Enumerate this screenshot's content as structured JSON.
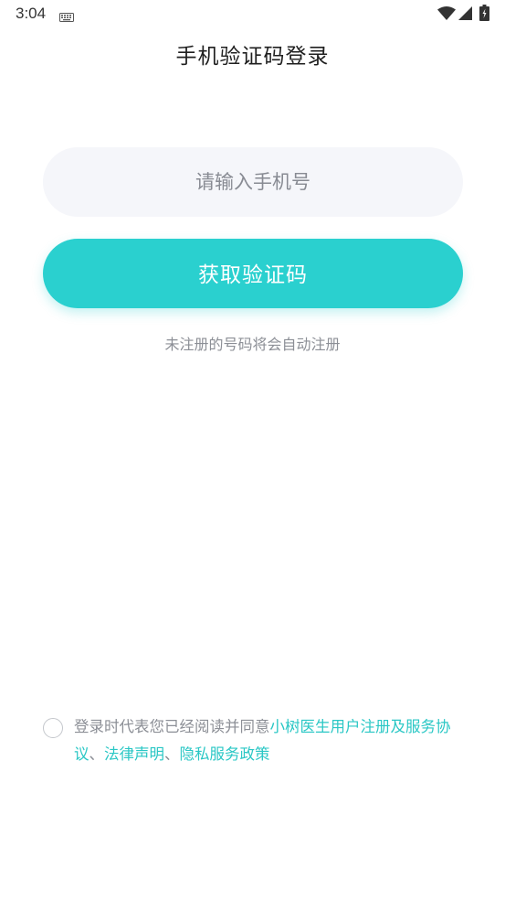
{
  "status_bar": {
    "time": "3:04"
  },
  "header": {
    "title": "手机验证码登录"
  },
  "form": {
    "phone_placeholder": "请输入手机号",
    "phone_value": "",
    "get_code_label": "获取验证码",
    "register_hint": "未注册的号码将会自动注册"
  },
  "agreement": {
    "checked": false,
    "prefix": "登录时代表您已经阅读并同意",
    "links": [
      {
        "label": "小树医生用户注册及服务协议"
      },
      {
        "label": "法律声明"
      },
      {
        "label": "隐私服务政策"
      }
    ],
    "separator": "、"
  },
  "colors": {
    "accent": "#2ad0cf",
    "input_bg": "#f5f6fa",
    "hint_text": "#8c8f96",
    "link": "#2ac7c5"
  },
  "icons": [
    "keyboard-icon",
    "wifi-icon",
    "signal-icon",
    "battery-icon"
  ]
}
